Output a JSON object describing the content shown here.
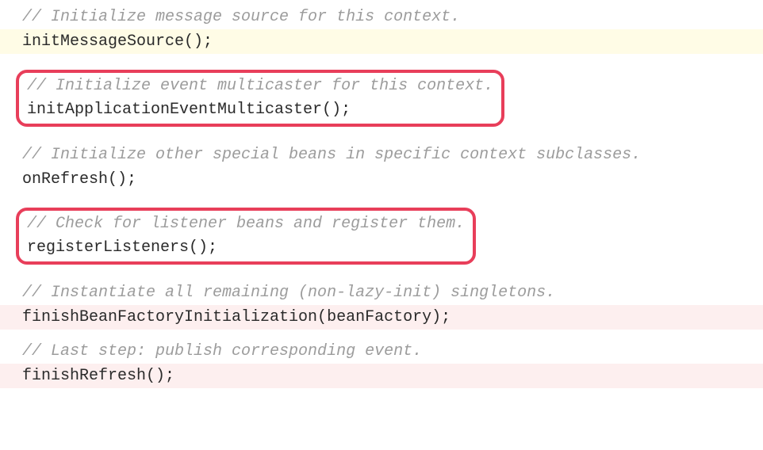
{
  "lines": {
    "comment1": "// Initialize message source for this context.",
    "code1": "initMessageSource();",
    "comment2": "// Initialize event multicaster for this context.",
    "code2": "initApplicationEventMulticaster();",
    "comment3": "// Initialize other special beans in specific context subclasses.",
    "code3": "onRefresh();",
    "comment4": "// Check for listener beans and register them.",
    "code4": "registerListeners();",
    "comment5": "// Instantiate all remaining (non-lazy-init) singletons.",
    "code5": "finishBeanFactoryInitialization(beanFactory);",
    "comment6": "// Last step: publish corresponding event.",
    "code6": "finishRefresh();"
  }
}
